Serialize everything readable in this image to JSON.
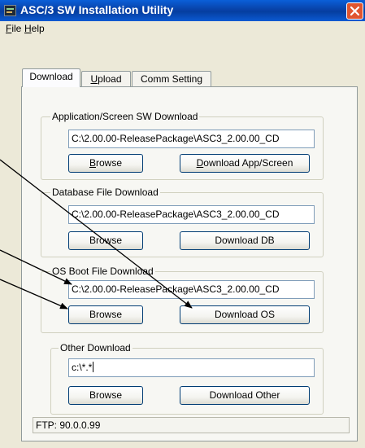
{
  "window": {
    "title": "ASC/3 SW Installation Utility"
  },
  "menu": {
    "file_label": "File",
    "file_mnemonic": "F",
    "file_rest": "ile",
    "help_label": "Help",
    "help_mnemonic": "H",
    "help_rest": "elp"
  },
  "tabs": {
    "download": "Download",
    "upload": "Upload",
    "upload_mnemonic": "U",
    "upload_rest": "pload",
    "comm_setting": "Comm Setting"
  },
  "groups": {
    "app_screen": {
      "title": "Application/Screen SW Download",
      "path": "C:\\2.00.00-ReleasePackage\\ASC3_2.00.00_CD",
      "browse_mnemonic": "B",
      "browse_rest": "rowse",
      "download_mnemonic": "D",
      "download_rest": "ownload App/Screen"
    },
    "database": {
      "title": "Database File Download",
      "path": "C:\\2.00.00-ReleasePackage\\ASC3_2.00.00_CD",
      "browse_label": "Browse",
      "download_label": "Download DB"
    },
    "os_boot": {
      "title": "OS Boot File Download",
      "path": "C:\\2.00.00-ReleasePackage\\ASC3_2.00.00_CD",
      "browse_label": "Browse",
      "download_label": "Download OS"
    },
    "other": {
      "title": "Other Download",
      "path": "c:\\*.*",
      "browse_label": "Browse",
      "download_label": "Download Other"
    }
  },
  "status": {
    "text": "FTP: 90.0.0.99"
  },
  "icons": {
    "app": "app-icon",
    "close": "close-icon"
  },
  "colors": {
    "titlebar": "#0842a8",
    "close_button": "#e0552f",
    "dialog_face": "#ece9d8",
    "button_border": "#003c74",
    "field_border": "#7f9db9"
  }
}
